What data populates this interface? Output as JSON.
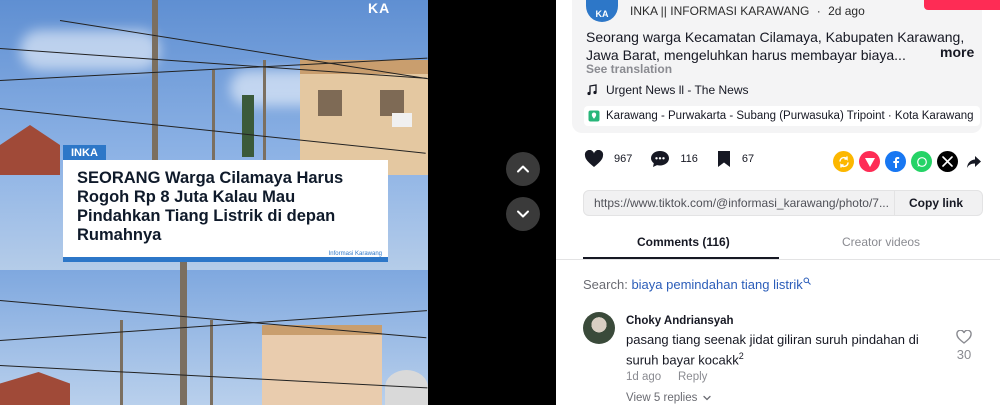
{
  "media": {
    "watermark": "KA",
    "card": {
      "tag": "INKA",
      "headline": "SEORANG Warga Cilamaya Harus Rogoh Rp 8 Juta Kalau Mau Pindahkan Tiang Listrik di depan Rumahnya",
      "credit": "Informasi Karawang"
    },
    "nav": {
      "up_icon": "chevron-up-icon",
      "down_icon": "chevron-down-icon"
    }
  },
  "post": {
    "author": "INKA || INFORMASI KARAWANG",
    "separator": "·",
    "age": "2d ago",
    "avatar_text": "KA",
    "description": "Seorang warga Kecamatan Cilamaya, Kabupaten Karawang, Jawa Barat, mengeluhkan harus membayar biaya...",
    "more_label": "more",
    "see_translation": "See translation",
    "music": "Urgent News ll - The News",
    "location": "Karawang - Purwakarta - Subang (Purwasuka) Tripoint · Kota Karawang"
  },
  "actions": {
    "likes": "967",
    "comments": "116",
    "saves": "67"
  },
  "share": {
    "url": "https://www.tiktok.com/@informasi_karawang/photo/7...",
    "copy_label": "Copy link"
  },
  "tabs": {
    "comments": "Comments (116)",
    "creator": "Creator videos"
  },
  "search": {
    "prefix": "Search:",
    "term": "biaya pemindahan tiang listrik"
  },
  "comment": {
    "user": "Choky Andriansyah",
    "text": "pasang tiang seenak jidat giliran suruh pindahan di suruh bayar kocakk",
    "sup": "2",
    "time": "1d ago",
    "reply_label": "Reply",
    "likes": "30",
    "view_replies": "View 5 replies"
  },
  "colors": {
    "accent_red": "#fe2c55",
    "inka_blue": "#2d77c8",
    "search_link": "#2b5db9"
  }
}
